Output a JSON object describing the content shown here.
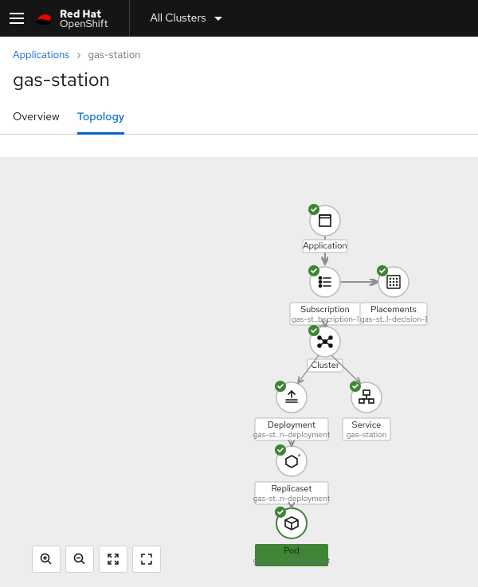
{
  "header": {
    "brand_line1": "Red Hat",
    "brand_line2": "OpenShift",
    "cluster_switcher": "All Clusters"
  },
  "breadcrumb": {
    "root": "Applications",
    "current": "gas-station"
  },
  "page_title": "gas-station",
  "tabs": {
    "overview": "Overview",
    "topology": "Topology",
    "active": "topology"
  },
  "toolbar": {
    "zoom_in": "Zoom in",
    "zoom_out": "Zoom out",
    "fit": "Fit to screen",
    "fullscreen": "Fullscreen"
  },
  "nodes": {
    "application": {
      "label": "Application",
      "sub": ""
    },
    "subscription": {
      "label": "Subscription",
      "sub": "gas-st..bscription-1"
    },
    "placements": {
      "label": "Placements",
      "sub": "gas-st..l-decision-1"
    },
    "cluster": {
      "label": "Cluster",
      "sub": ""
    },
    "deployment": {
      "label": "Deployment",
      "sub": "gas-st..n-deployment"
    },
    "service": {
      "label": "Service",
      "sub": "gas-station"
    },
    "replicaset": {
      "label": "Replicaset",
      "sub": "gas-st..n-deployment"
    },
    "pod": {
      "label": "Pod",
      "sub": "gas-st..n-deployment"
    }
  }
}
